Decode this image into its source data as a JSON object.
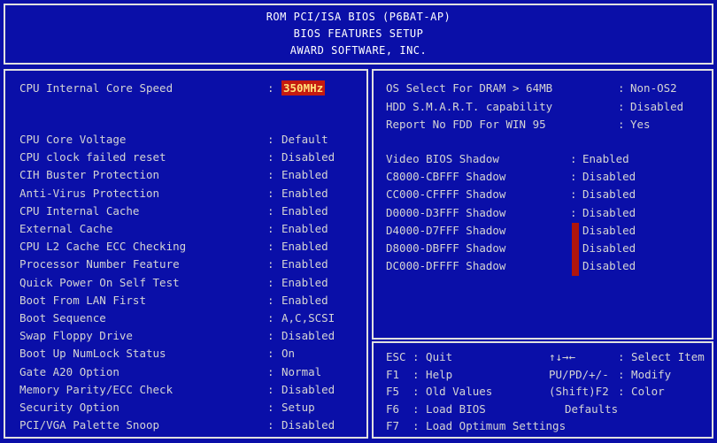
{
  "header": {
    "line1": "ROM PCI/ISA BIOS (P6BAT-AP)",
    "line2": "BIOS FEATURES SETUP",
    "line3": "AWARD SOFTWARE, INC."
  },
  "left": {
    "cpu_speed": {
      "label": "CPU Internal Core Speed",
      "value": "350MHz"
    },
    "items": [
      {
        "label": "CPU Core Voltage",
        "value": "Default"
      },
      {
        "label": "CPU clock failed reset",
        "value": "Disabled"
      },
      {
        "label": "CIH Buster Protection",
        "value": "Enabled"
      },
      {
        "label": "Anti-Virus Protection",
        "value": "Enabled"
      },
      {
        "label": "CPU Internal Cache",
        "value": "Enabled"
      },
      {
        "label": "External Cache",
        "value": "Enabled"
      },
      {
        "label": "CPU L2 Cache ECC Checking",
        "value": "Enabled"
      },
      {
        "label": "Processor Number Feature",
        "value": "Enabled"
      },
      {
        "label": "Quick Power On Self Test",
        "value": "Enabled"
      },
      {
        "label": "Boot From LAN First",
        "value": "Enabled"
      },
      {
        "label": "Boot Sequence",
        "value": "A,C,SCSI"
      },
      {
        "label": "Swap Floppy Drive",
        "value": "Disabled"
      },
      {
        "label": "Boot Up NumLock Status",
        "value": "On"
      },
      {
        "label": "Gate A20 Option",
        "value": "Normal"
      },
      {
        "label": "Memory Parity/ECC Check",
        "value": "Disabled"
      },
      {
        "label": "Security Option",
        "value": "Setup"
      },
      {
        "label": "PCI/VGA Palette Snoop",
        "value": "Disabled"
      }
    ]
  },
  "right": {
    "top": [
      {
        "label": "OS Select For DRAM > 64MB",
        "value": "Non-OS2"
      },
      {
        "label": "HDD S.M.A.R.T. capability",
        "value": "Disabled"
      },
      {
        "label": "Report No FDD For WIN 95",
        "value": "Yes"
      }
    ],
    "shadow": [
      {
        "label": "Video  BIOS Shadow",
        "value": "Enabled"
      },
      {
        "label": "C8000-CBFFF Shadow",
        "value": "Disabled"
      },
      {
        "label": "CC000-CFFFF Shadow",
        "value": "Disabled"
      },
      {
        "label": "D0000-D3FFF Shadow",
        "value": "Disabled"
      },
      {
        "label": "D4000-D7FFF Shadow",
        "value": "Disabled"
      },
      {
        "label": "D8000-DBFFF Shadow",
        "value": "Disabled"
      },
      {
        "label": "DC000-DFFFF Shadow",
        "value": "Disabled"
      }
    ]
  },
  "keys": [
    {
      "key": "ESC",
      "action": ": Quit",
      "rkey": "↑↓→←",
      "raction": ": Select Item"
    },
    {
      "key": "F1",
      "action": ": Help",
      "rkey": "PU/PD/+/-",
      "raction": ": Modify"
    },
    {
      "key": "F5",
      "action": ": Old Values",
      "rkey": "(Shift)F2",
      "raction": ": Color"
    },
    {
      "key": "F6",
      "action": ": Load BIOS",
      "rkey": "",
      "raction": "Defaults"
    },
    {
      "key": "F7",
      "action": ": Load Optimum Settings",
      "rkey": "",
      "raction": ""
    }
  ],
  "colors": {
    "background": "#0a0fa8",
    "highlight": "#c51a10",
    "text": "#d4d4d4"
  }
}
